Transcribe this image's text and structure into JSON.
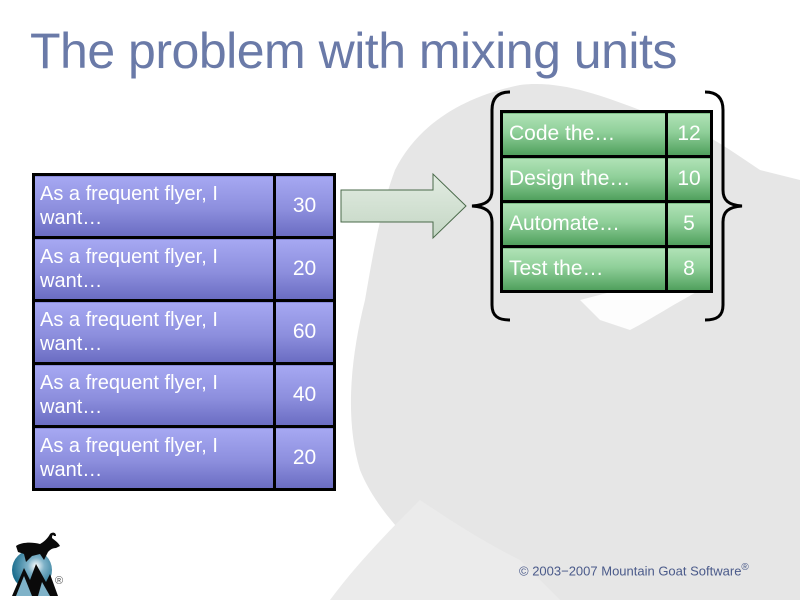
{
  "slide": {
    "title": "The problem with mixing units",
    "stories": [
      {
        "text": "As a frequent flyer, I want…",
        "points": "30"
      },
      {
        "text": "As a frequent flyer, I want…",
        "points": "20"
      },
      {
        "text": "As a frequent flyer, I want…",
        "points": "60"
      },
      {
        "text": "As a frequent flyer, I want…",
        "points": "40"
      },
      {
        "text": "As a frequent flyer, I want…",
        "points": "20"
      }
    ],
    "tasks": [
      {
        "text": "Code the…",
        "hours": "12"
      },
      {
        "text": "Design the…",
        "hours": "10"
      },
      {
        "text": "Automate…",
        "hours": "5"
      },
      {
        "text": "Test the…",
        "hours": "8"
      }
    ],
    "icons": {
      "arrow": "right-arrow-icon",
      "left_brace": "left-brace-icon",
      "right_brace": "right-brace-icon",
      "logo": "mountain-goat-logo-icon"
    },
    "footer": {
      "logo_registered": "®",
      "copyright": "© 2003−2007 Mountain Goat Software",
      "copyright_registered": "®"
    },
    "colors": {
      "title": "#6a7aa8",
      "story_fill": "#8c8edd",
      "task_fill": "#8fcf99",
      "copyright": "#4a5a8a"
    }
  }
}
